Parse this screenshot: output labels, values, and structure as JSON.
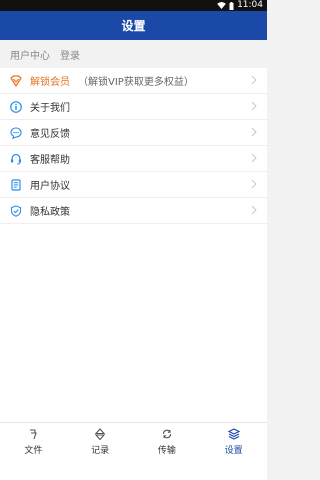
{
  "status_bar": {
    "time": "11:04"
  },
  "header": {
    "title": "设置"
  },
  "user_section": {
    "label": "用户中心",
    "login": "登录"
  },
  "menu": {
    "items": [
      {
        "label": "解锁会员",
        "sub": "（解锁VIP获取更多权益）",
        "icon": "vip-badge-icon"
      },
      {
        "label": "关于我们",
        "icon": "info-icon"
      },
      {
        "label": "意见反馈",
        "icon": "chat-bubble-icon"
      },
      {
        "label": "客服帮助",
        "icon": "headset-icon"
      },
      {
        "label": "用户协议",
        "icon": "document-icon"
      },
      {
        "label": "隐私政策",
        "icon": "shield-icon"
      }
    ]
  },
  "tabbar": {
    "items": [
      {
        "label": "文件",
        "icon": "file-tab-icon"
      },
      {
        "label": "记录",
        "icon": "record-tab-icon"
      },
      {
        "label": "传输",
        "icon": "transfer-tab-icon"
      },
      {
        "label": "设置",
        "icon": "settings-tab-icon"
      }
    ],
    "active": "设置"
  },
  "colors": {
    "primary": "#1b49a8",
    "vip": "#e8731e",
    "icon_blue": "#2b8ce8"
  }
}
